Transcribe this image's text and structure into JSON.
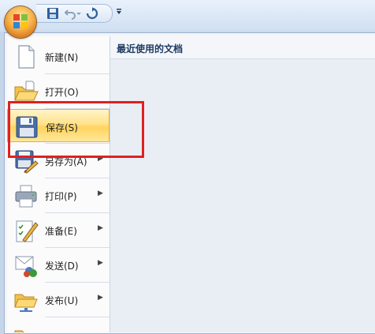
{
  "quick_access": {
    "icons": [
      "save-icon",
      "undo-icon",
      "redo-icon",
      "customize-dropdown-icon"
    ]
  },
  "recent": {
    "title": "最近使用的文档"
  },
  "menu": {
    "items": [
      {
        "label": "新建(N)",
        "icon": "new-document-icon",
        "submenu": false
      },
      {
        "label": "打开(O)",
        "icon": "open-folder-icon",
        "submenu": false
      },
      {
        "label": "保存(S)",
        "icon": "save-icon",
        "submenu": false,
        "highlighted": true
      },
      {
        "label": "另存为(A)",
        "icon": "save-as-icon",
        "submenu": true
      },
      {
        "label": "打印(P)",
        "icon": "printer-icon",
        "submenu": true
      },
      {
        "label": "准备(E)",
        "icon": "prepare-icon",
        "submenu": true
      },
      {
        "label": "发送(D)",
        "icon": "send-icon",
        "submenu": true
      },
      {
        "label": "发布(U)",
        "icon": "publish-icon",
        "submenu": true
      }
    ]
  },
  "colors": {
    "highlight": "#ffd35e",
    "annotation_box": "#e02020"
  }
}
